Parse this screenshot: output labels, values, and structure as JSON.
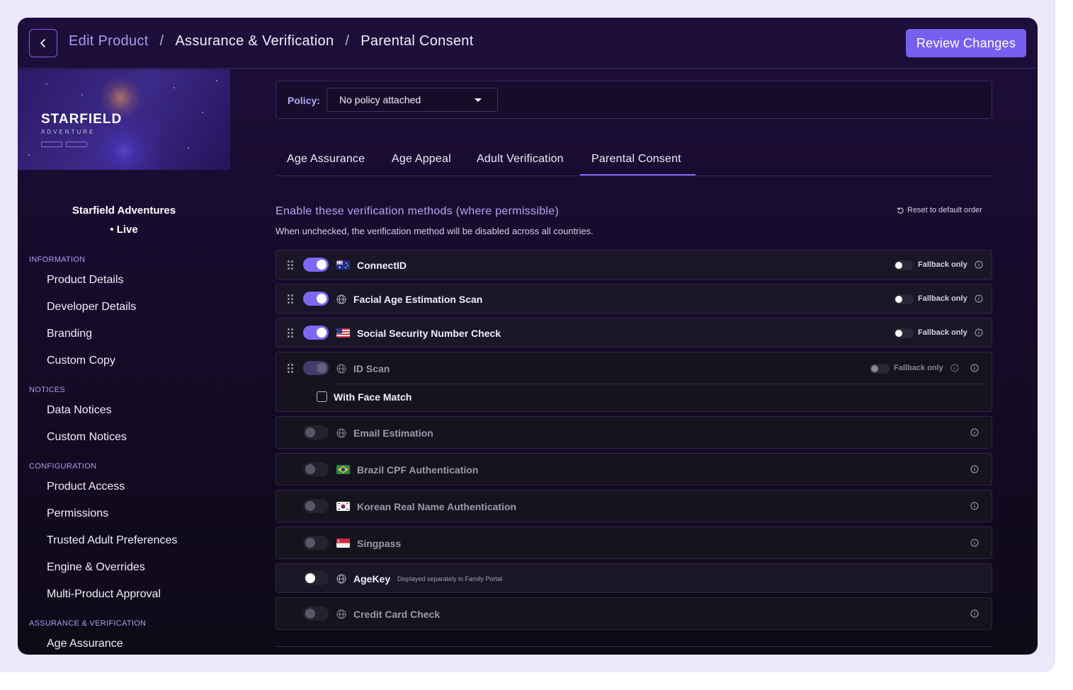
{
  "header": {
    "breadcrumbs": [
      "Edit Product",
      "Assurance & Verification",
      "Parental Consent"
    ],
    "separator": "/",
    "review_label": "Review Changes"
  },
  "sidebar": {
    "banner_title": "STARFIELD",
    "banner_subtitle": "ADVENTURE",
    "product_name": "Starfield Adventures",
    "status": "• Live",
    "sections": [
      {
        "label": "INFORMATION",
        "items": [
          "Product Details",
          "Developer Details",
          "Branding",
          "Custom Copy"
        ]
      },
      {
        "label": "NOTICES",
        "items": [
          "Data Notices",
          "Custom Notices"
        ]
      },
      {
        "label": "CONFIGURATION",
        "items": [
          "Product Access",
          "Permissions",
          "Trusted Adult Preferences",
          "Engine & Overrides",
          "Multi-Product Approval"
        ]
      },
      {
        "label": "ASSURANCE & VERIFICATION",
        "items": [
          "Age Assurance"
        ]
      }
    ]
  },
  "policy": {
    "label": "Policy:",
    "value": "No policy attached"
  },
  "tabs": [
    "Age Assurance",
    "Age Appeal",
    "Adult Verification",
    "Parental Consent"
  ],
  "active_tab": "Parental Consent",
  "methods_section": {
    "title": "Enable these verification methods (where permissible)",
    "description": "When unchecked, the verification method will be disabled across all countries.",
    "reset_label": "Reset to default order",
    "fallback_label": "Fallback only",
    "methods": [
      {
        "name": "ConnectID",
        "icon": "flag-australia",
        "enabled": true,
        "fallback_only": false
      },
      {
        "name": "Facial Age Estimation Scan",
        "icon": "globe-icon",
        "enabled": true,
        "fallback_only": false
      },
      {
        "name": "Social Security Number Check",
        "icon": "flag-usa",
        "enabled": true,
        "fallback_only": false
      },
      {
        "name": "ID Scan",
        "icon": "globe-icon",
        "enabled": true,
        "disabled_style": true,
        "fallback_only": false,
        "sub_option": "With Face Match"
      },
      {
        "name": "Email Estimation",
        "icon": "globe-icon",
        "enabled": false
      },
      {
        "name": "Brazil CPF Authentication",
        "icon": "flag-brazil",
        "enabled": false
      },
      {
        "name": "Korean Real Name Authentication",
        "icon": "flag-korea",
        "enabled": false
      },
      {
        "name": "Singpass",
        "icon": "flag-singapore",
        "enabled": false
      },
      {
        "name": "AgeKey",
        "icon": "globe-icon",
        "enabled": false,
        "note": "Displayed separately in Family Portal"
      },
      {
        "name": "Credit Card Check",
        "icon": "globe-icon",
        "enabled": false
      }
    ]
  },
  "colors": {
    "accent": "#7760ef",
    "accent_light": "#a99cf2",
    "bg_dark": "#160b2b"
  }
}
